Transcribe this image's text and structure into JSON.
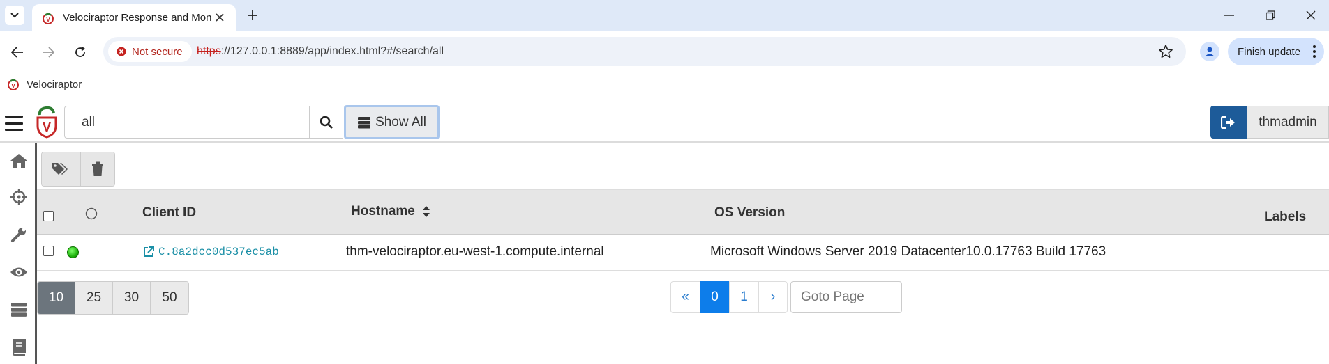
{
  "browser": {
    "tab_title": "Velociraptor Response and Monitoring",
    "url_scheme": "https",
    "url_rest": "://127.0.0.1:8889/app/index.html?#/search/all",
    "security_chip": "Not secure",
    "update_button": "Finish update"
  },
  "bookmarks": {
    "items": [
      {
        "label": "Velociraptor"
      }
    ]
  },
  "app": {
    "search_value": "all",
    "show_all_label": "Show All",
    "username": "thmadmin"
  },
  "table": {
    "headers": {
      "client_id": "Client ID",
      "hostname": "Hostname",
      "os_version": "OS Version",
      "labels": "Labels"
    },
    "rows": [
      {
        "status": "online",
        "client_id": "C.8a2dcc0d537ec5ab",
        "hostname": "thm-velociraptor.eu-west-1.compute.internal",
        "os_version": "Microsoft Windows Server 2019 Datacenter10.0.17763 Build 17763",
        "labels": ""
      }
    ]
  },
  "pagination": {
    "page_sizes": [
      "10",
      "25",
      "30",
      "50"
    ],
    "active_page_size": "10",
    "first": "«",
    "pages": [
      "0",
      "1"
    ],
    "active_page": "0",
    "next": "›",
    "goto_placeholder": "Goto Page"
  },
  "colors": {
    "accent": "#0d7dea",
    "logout": "#1d5b99",
    "online": "#1fb30d",
    "link": "#1a8fa6"
  }
}
